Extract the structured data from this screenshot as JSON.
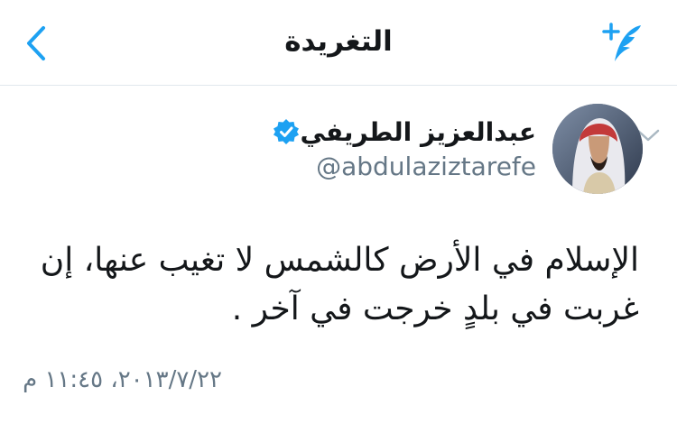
{
  "navbar": {
    "title": "التغريدة",
    "compose_icon": "compose-tweet-icon",
    "back_icon": "chevron-left-icon"
  },
  "tweet": {
    "author_name": "عبدالعزيز الطريفي",
    "handle": "@abdulaziztarefe",
    "verified_icon": "verified-badge-icon",
    "text": "الإسلام في الأرض كالشمس لا تغيب عنها، إن غربت في بلدٍ خرجت في آخر .",
    "timestamp": "٢٠١٣/٧/٢٢، ١١:٤٥ م"
  },
  "colors": {
    "accent": "#1da1f2",
    "text": "#14171a",
    "secondary": "#657786",
    "divider": "#e1e8ed"
  }
}
